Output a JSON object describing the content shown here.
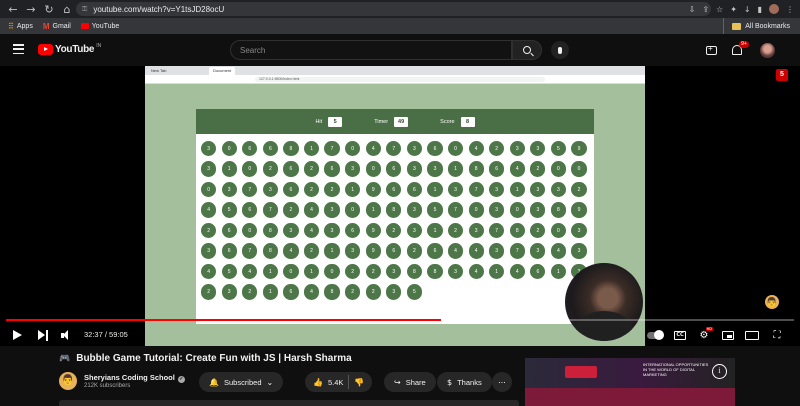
{
  "browser": {
    "url": "youtube.com/watch?v=Y1tsJD28ocU",
    "bookmarks": [
      {
        "label": "Apps",
        "color": "#ea4335"
      },
      {
        "label": "Gmail",
        "color": "#ea4335"
      },
      {
        "label": "YouTube",
        "color": "#ff0000"
      }
    ],
    "all_bookmarks": "All Bookmarks"
  },
  "header": {
    "logo": "YouTube",
    "country": "IN",
    "search_placeholder": "Search",
    "notifications": "9+"
  },
  "player": {
    "corner_badge": "5",
    "inner_tab_1": "New Tab",
    "inner_tab_2": "Document",
    "inner_url": "127.0.0.1:5500/index.html",
    "time": "32:37 / 59:05",
    "progress": 0.552,
    "game": {
      "hit_label": "Hit",
      "hit_value": "5",
      "timer_label": "Timer",
      "timer_value": "49",
      "score_label": "Score",
      "score_value": "8",
      "rows": [
        [
          "3",
          "0",
          "6",
          "6",
          "8",
          "1",
          "7",
          "0",
          "4",
          "7",
          "3",
          "6",
          "0",
          "4",
          "2",
          "3",
          "3",
          "5"
        ],
        [
          "9",
          "3",
          "1",
          "0",
          "2",
          "6",
          "2",
          "6",
          "3",
          "0",
          "6",
          "3",
          "3",
          "1",
          "8",
          "6",
          "4",
          "2"
        ],
        [
          "0",
          "0",
          "0",
          "3",
          "7",
          "3",
          "6",
          "2",
          "2",
          "1",
          "9",
          "6",
          "6",
          "1",
          "3",
          "7",
          "3",
          "1"
        ],
        [
          "3",
          "3",
          "2",
          "4",
          "5",
          "6",
          "7",
          "2",
          "4",
          "3",
          "0",
          "1",
          "8",
          "3",
          "5",
          "7",
          "0",
          "3"
        ],
        [
          "0",
          "3",
          "8",
          "9",
          "2",
          "6",
          "0",
          "8",
          "3",
          "4",
          "3",
          "6",
          "9",
          "2",
          "3",
          "1",
          "2",
          "3"
        ],
        [
          "7",
          "8",
          "2",
          "0",
          "3",
          "3",
          "6",
          "7",
          "8",
          "4",
          "2",
          "1",
          "3",
          "9",
          "6",
          "2",
          "6",
          "4"
        ],
        [
          "4",
          "3",
          "7",
          "3",
          "4",
          "3",
          "4",
          "5",
          "4",
          "1",
          "0",
          "1",
          "0",
          "2",
          "2",
          "3",
          "8",
          "8"
        ],
        [
          "3",
          "4",
          "1",
          "4",
          "6",
          "1",
          "3",
          "2",
          "3",
          "2",
          "1",
          "6",
          "4",
          "8",
          "2",
          "2",
          "3",
          "5"
        ]
      ]
    }
  },
  "video": {
    "title": "Bubble Game Tutorial: Create Fun with JS | Harsh Sharma",
    "channel": "Sheryians Coding School",
    "subscribers": "212K subscribers",
    "subscribed_label": "Subscribed",
    "likes": "5.4K",
    "share_label": "Share",
    "thanks_label": "Thanks",
    "more_label": "..."
  },
  "ad": {
    "text": "INTERNATIONAL OPPORTUNITIES IN THE WORLD OF DIGITAL MARKETING",
    "info": "i"
  }
}
